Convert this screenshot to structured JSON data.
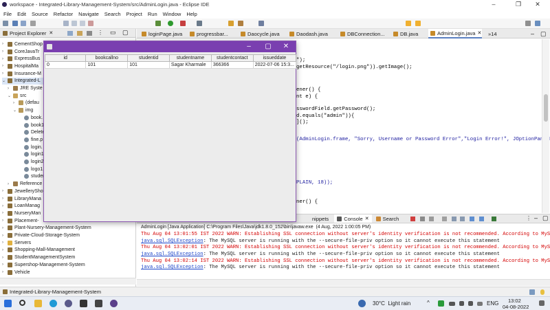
{
  "window": {
    "title": "workspace - Integrated-Library-Management-System/src/AdminLogin.java - Eclipse IDE"
  },
  "menu": [
    "File",
    "Edit",
    "Source",
    "Refactor",
    "Navigate",
    "Search",
    "Project",
    "Run",
    "Window",
    "Help"
  ],
  "explorer": {
    "title": "Project Explorer",
    "items": [
      "CementShop",
      "CoreJavaTr",
      "ExpressBus",
      "HospitalMa",
      "Insurance-M",
      "Integrated-L",
      "JRE Syste",
      "src",
      "(defau",
      "img",
      "book.",
      "book1",
      "Delete",
      "fine.p",
      "login.",
      "login1",
      "login2",
      "logo1.",
      "studen",
      "Reference",
      "JewelleryShop",
      "LibraryMana",
      "LoanManag",
      "NurseryMan",
      "Placement-",
      "Plant-Nursery-Management-System",
      "Private-Cloud-Storage-System",
      "Servers",
      "Shopping-Mall-Management",
      "StudentManagementSystem",
      "Supershop-Management-System",
      "Vehicle"
    ]
  },
  "editor": {
    "tabs": [
      "loginPage.java",
      "progressbar...",
      "Daocycle.java",
      "Daodash.java",
      "DBConnection...",
      "DB.java",
      "AdminLogin.java"
    ],
    "overflow": "»14",
    "code": [
      "\");",
      "getResource(\"/login.png\")).getImage();",
      "ener() {",
      "nt e) {",
      "sswordField.getPassword();",
      "d.equals(\"admin\")){",
      "]();",
      "(AdminLogin.frame, \"Sorry, Username or Password Error\",\"Login Error!\", JOptionPane.ER",
      "PLAIN, 18));",
      "ner() {"
    ]
  },
  "console": {
    "tabs": [
      "nippets",
      "Console",
      "Search"
    ],
    "header": "AdminLogin [Java Application] C:\\Program Files\\Java\\jdk1.8.0_152\\bin\\javaw.exe  (4 Aug, 2022 1:00:05 PM)",
    "warn1": "Thu Aug 04 13:01:55 IST 2022 WARN: Establishing SSL connection without server's identity verification is not recommended. According to MySQL 5",
    "warn2": "Thu Aug 04 13:02:01 IST 2022 WARN: Establishing SSL connection without server's identity verification is not recommended. According to MySQL 5",
    "warn3": "Thu Aug 04 13:02:14 IST 2022 WARN: Establishing SSL connection without server's identity verification is not recommended. According to MySQL 5",
    "exc": "java.sql.SQLException",
    "excmsg": ": The MySQL server is running with the --secure-file-priv option so it cannot execute this statement"
  },
  "status": {
    "text": "Integrated-Library-Management-System"
  },
  "dialog": {
    "columns": [
      "id",
      "bookcallno",
      "studentid",
      "studentname",
      "studentcontact",
      "issueddate"
    ],
    "rows": [
      [
        "0",
        "101",
        "101",
        "Sagar Kharmale",
        "366366",
        "2022-07-06 15:3..."
      ]
    ]
  },
  "taskbar": {
    "weather": "30°C  Light rain",
    "lang": "ENG",
    "time": "13:02",
    "date": "04-08-2022"
  },
  "colors": {
    "accent": "#7a3fb0",
    "warn": "#d40000",
    "link": "#1b44c8"
  }
}
